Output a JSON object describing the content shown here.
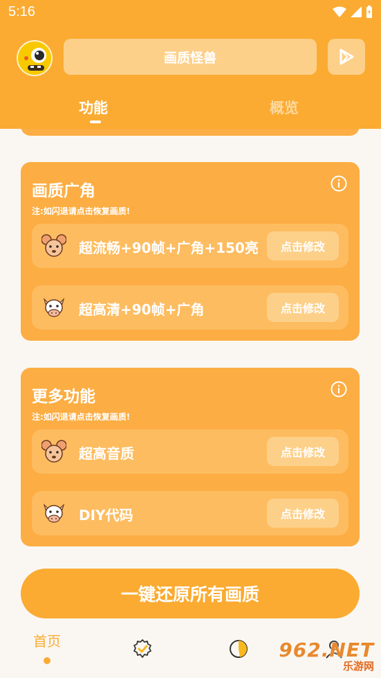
{
  "status_bar": {
    "time": "5:16"
  },
  "header": {
    "title": "画质怪兽"
  },
  "tabs": [
    {
      "label": "功能",
      "active": true
    },
    {
      "label": "概览",
      "active": false
    }
  ],
  "cards": [
    {
      "title": "画质广角",
      "note": "注:如闪退请点击恢复画质!",
      "rows": [
        {
          "label": "超流畅+90帧+广角+150亮",
          "icon": "mouse-icon",
          "button": "点击修改"
        },
        {
          "label": "超高清+90帧+广角",
          "icon": "cow-icon",
          "button": "点击修改"
        }
      ]
    },
    {
      "title": "更多功能",
      "note": "注:如闪退请点击恢复画质!",
      "rows": [
        {
          "label": "超高音质",
          "icon": "mouse-icon",
          "button": "点击修改"
        },
        {
          "label": "DIY代码",
          "icon": "cow-icon",
          "button": "点击修改"
        }
      ]
    }
  ],
  "restore_button": "一键还原所有画质",
  "bottom_nav": {
    "home_label": "首页",
    "icons": [
      "badge-check-icon",
      "pie-chart-icon",
      "user-icon"
    ]
  },
  "watermark": {
    "main": "962.NET",
    "sub": "乐游网"
  },
  "colors": {
    "primary": "#fbab32",
    "card": "#fcad43",
    "row": "#fdbc60",
    "button": "#fdd08a",
    "background": "#faf7f2"
  }
}
